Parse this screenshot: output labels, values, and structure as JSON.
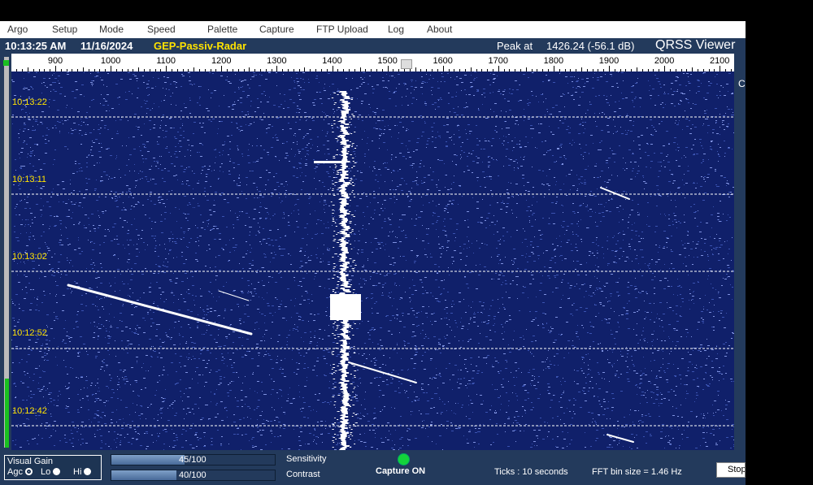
{
  "menu": [
    "Argo",
    "Setup",
    "Mode",
    "Speed",
    "Palette",
    "Capture",
    "FTP Upload",
    "Log",
    "About"
  ],
  "status": {
    "time": "10:13:25 AM",
    "date": "11/16/2024",
    "station": "GEP-Passiv-Radar",
    "peak_label": "Peak at",
    "peak_value": "1426.24 (-56.1 dB)",
    "brand": "QRSS Viewer"
  },
  "scale": {
    "labels": [
      "900",
      "1000",
      "1100",
      "1200",
      "1300",
      "1400",
      "1500",
      "1600",
      "1700",
      "1800",
      "1900",
      "2000",
      "2100"
    ]
  },
  "waterfall": {
    "time_labels": [
      "10:13:22",
      "10:13:11",
      "10:13:02",
      "10:12:52",
      "10:12:42"
    ],
    "cutoff_text": "C"
  },
  "controls": {
    "visual_gain": "Visual Gain",
    "agc": "Agc",
    "lo": "Lo",
    "hi": "Hi",
    "sensitivity_value": "45/100",
    "sensitivity_fraction": 0.45,
    "sensitivity_label": "Sensitivity",
    "contrast_value": "40/100",
    "contrast_fraction": 0.4,
    "contrast_label": "Contrast",
    "capture_status": "Capture ON",
    "ticks": "Ticks  : 10 seconds",
    "fft": "FFT bin size = 1.46 Hz",
    "stop": "Stop"
  },
  "colors": {
    "waterfall_bg": "#10206a",
    "panel_bg": "#233a5c",
    "time_label": "#ffe300",
    "capture_light": "#14d43a"
  }
}
